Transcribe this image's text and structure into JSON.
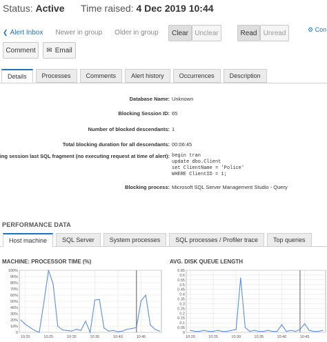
{
  "header": {
    "status_label": "Status:",
    "status_value": "Active",
    "time_label": "Time raised:",
    "time_value": "4 Dec 2019 10:44"
  },
  "nav": {
    "alert_inbox": "Alert Inbox",
    "newer": "Newer in group",
    "older": "Older in group"
  },
  "buttons": {
    "clear": "Clear",
    "unclear": "Unclear",
    "read": "Read",
    "unread": "Unread",
    "comment": "Comment",
    "email": "Email",
    "config": "Con"
  },
  "tabs": [
    "Details",
    "Processes",
    "Comments",
    "Alert history",
    "Occurrences",
    "Description"
  ],
  "details": {
    "database_name_label": "Database Name:",
    "database_name": "Unknown",
    "blocking_session_label": "Blocking Session ID:",
    "blocking_session": "65",
    "blocked_desc_label": "Number of blocked descendants:",
    "blocked_desc": "1",
    "duration_label": "Total blocking duration for all descendants:",
    "duration": "00:06:45",
    "sql_label": "Blocking session last SQL fragment (no executing request at time of alert):",
    "sql_lines": [
      "begin tran",
      "update dbo.Client",
      "set ClientName = 'Police'",
      "WHERE ClientID = 1;"
    ],
    "process_label": "Blocking process:",
    "process": "Microsoft SQL Server Management Studio - Query"
  },
  "performance": {
    "title": "PERFORMANCE DATA",
    "tabs": [
      "Host machine",
      "SQL Server",
      "System processes",
      "SQL processes / Profiler trace",
      "Top queries"
    ]
  },
  "chart_data": [
    {
      "type": "line",
      "title": "MACHINE: PROCESSOR TIME (%)",
      "x": [
        "10:19",
        "10:20",
        "10:21",
        "10:22",
        "10:23",
        "10:24",
        "10:25",
        "10:26",
        "10:27",
        "10:28",
        "10:29",
        "10:30",
        "10:31",
        "10:32",
        "10:33",
        "10:34",
        "10:35",
        "10:36",
        "10:37",
        "10:38",
        "10:39",
        "10:40",
        "10:41",
        "10:42",
        "10:43",
        "10:44",
        "10:45",
        "10:46",
        "10:47",
        "10:48",
        "10:49"
      ],
      "y": [
        20,
        13,
        8,
        3,
        0,
        48,
        100,
        78,
        10,
        4,
        3,
        2,
        5,
        3,
        18,
        0,
        52,
        53,
        7,
        2,
        3,
        1,
        2,
        5,
        6,
        8,
        51,
        60,
        12,
        5,
        2
      ],
      "xticks": [
        "10:20",
        "10:25",
        "10:30",
        "10:35",
        "10:40",
        "10:45"
      ],
      "yticks": [
        "0",
        "10%",
        "20%",
        "30%",
        "40%",
        "50%",
        "60%",
        "70%",
        "80%",
        "90%",
        "100%"
      ],
      "ylim": [
        0,
        100
      ],
      "marker_x": "10:44",
      "color": "#5b8ee6",
      "grid": true
    },
    {
      "type": "line",
      "title": "AVG. DISK QUEUE LENGTH",
      "x": [
        "10:20",
        "10:21",
        "10:22",
        "10:23",
        "10:24",
        "10:25",
        "10:26",
        "10:27",
        "10:28",
        "10:29",
        "10:30",
        "10:31",
        "10:32",
        "10:33",
        "10:34",
        "10:35",
        "10:36",
        "10:37",
        "10:38",
        "10:39",
        "10:40",
        "10:41",
        "10:42",
        "10:43",
        "10:44",
        "10:45",
        "10:46",
        "10:47",
        "10:48",
        "10:49"
      ],
      "y": [
        0.02,
        0.01,
        0.01,
        0.02,
        0.01,
        0.01,
        0.02,
        0.01,
        0.01,
        0.02,
        0.03,
        0.57,
        0.05,
        0.01,
        0.02,
        0.01,
        0.01,
        0.02,
        0.01,
        0.01,
        0.08,
        0.01,
        0.02,
        0.01,
        0.03,
        0.09,
        0.02,
        0.01,
        0.01,
        0.02
      ],
      "xticks": [
        "10:20",
        "10:25",
        "10:30",
        "10:35",
        "10:40",
        "10:45"
      ],
      "yticks": [
        "0",
        "0.05",
        "0.1",
        "0.15",
        "0.2",
        "0.25",
        "0.3",
        "0.35",
        "0.4",
        "0.45",
        "0.5",
        "0.55",
        "0.6",
        "0.65"
      ],
      "ylim": [
        0,
        0.65
      ],
      "marker_x": "10:44",
      "color": "#5b8ee6",
      "grid": true
    }
  ]
}
